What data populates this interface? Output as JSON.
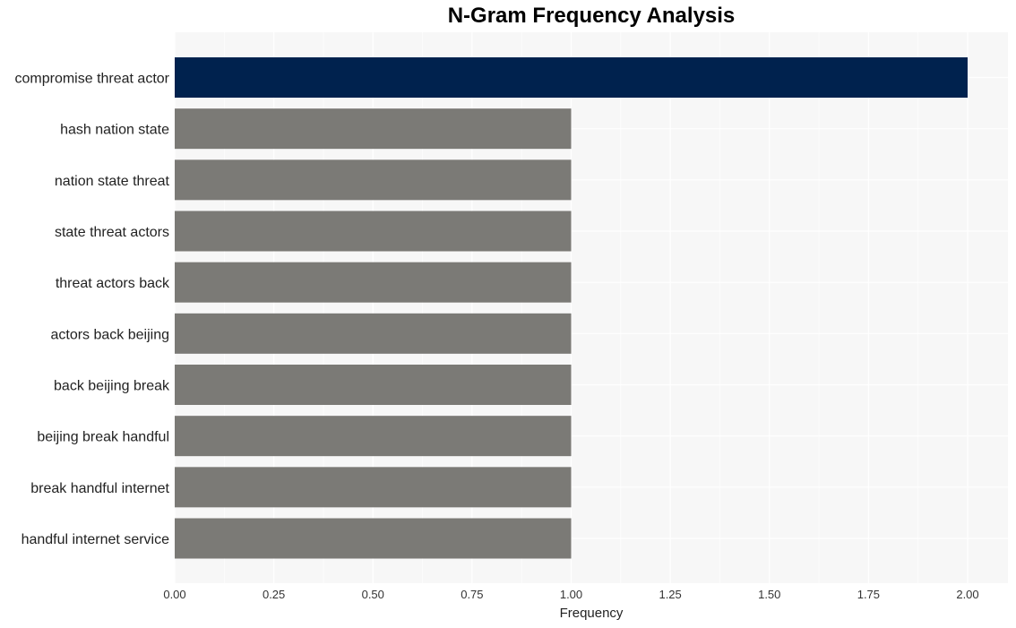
{
  "chart_data": {
    "type": "bar",
    "orientation": "horizontal",
    "title": "N-Gram Frequency Analysis",
    "xlabel": "Frequency",
    "ylabel": "",
    "xlim": [
      0,
      2.1
    ],
    "x_ticks": [
      "0.00",
      "0.25",
      "0.50",
      "0.75",
      "1.00",
      "1.25",
      "1.50",
      "1.75",
      "2.00"
    ],
    "grid": true,
    "categories": [
      "compromise threat actor",
      "hash nation state",
      "nation state threat",
      "state threat actors",
      "threat actors back",
      "actors back beijing",
      "back beijing break",
      "beijing break handful",
      "break handful internet",
      "handful internet service"
    ],
    "values": [
      2,
      1,
      1,
      1,
      1,
      1,
      1,
      1,
      1,
      1
    ],
    "colors": {
      "highlight": "#00224e",
      "default": "#7b7a76",
      "panel_background": "#f7f7f7",
      "grid": "#ffffff"
    }
  }
}
